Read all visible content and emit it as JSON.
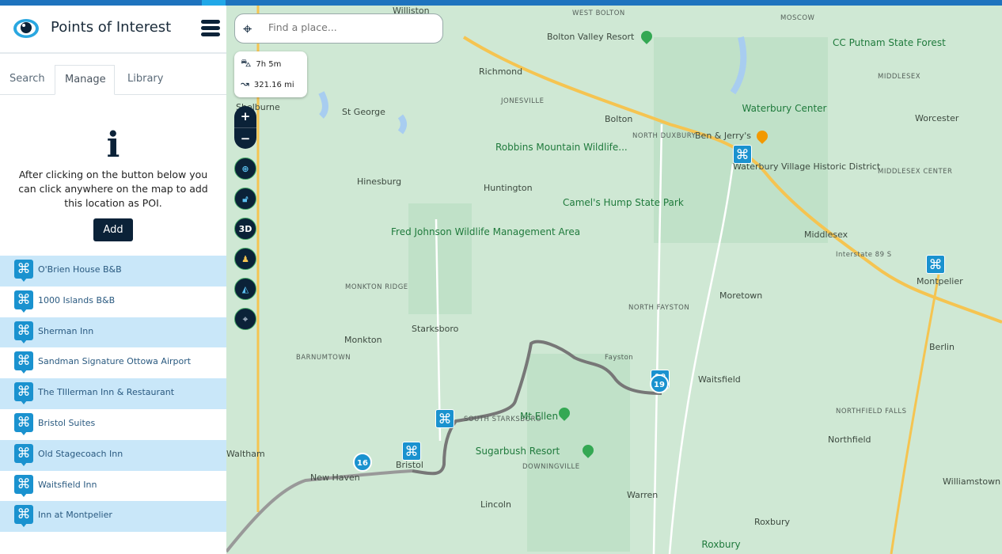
{
  "app": {
    "title": "Points of Interest",
    "logo": "eye-icon",
    "menu_icon": "hamburger-icon"
  },
  "tabs": [
    {
      "label": "Search"
    },
    {
      "label": "Manage",
      "active": true
    },
    {
      "label": "Library"
    }
  ],
  "manage": {
    "info_icon": "i",
    "text": "After clicking on the button below you can click anywhere on the map to add this location as POI.",
    "add_label": "Add"
  },
  "poi_list": [
    {
      "name": "O'Brien House B&B"
    },
    {
      "name": "1000 Islands B&B"
    },
    {
      "name": "Sherman Inn"
    },
    {
      "name": "Sandman Signature Ottowa Airport"
    },
    {
      "name": "The TIllerman Inn & Restaurant"
    },
    {
      "name": "Bristol Suites"
    },
    {
      "name": "Old Stagecoach Inn"
    },
    {
      "name": "Waitsfield Inn"
    },
    {
      "name": "Inn at Montpelier"
    }
  ],
  "map": {
    "search_placeholder": "Find a place...",
    "duration": "7h 5m",
    "distance": "321.16 mi",
    "controls": {
      "zoom_in": "+",
      "zoom_out": "−",
      "three_d": "3D"
    },
    "marker_badges": [
      "16",
      "19"
    ],
    "labels": [
      {
        "t": "Williston"
      },
      {
        "t": "WEST BOLTON"
      },
      {
        "t": "MOSCOW"
      },
      {
        "t": "Bolton Valley Resort"
      },
      {
        "t": "CC Putnam State Forest"
      },
      {
        "t": "Richmond"
      },
      {
        "t": "MIDDLESEX"
      },
      {
        "t": "JONESVILLE"
      },
      {
        "t": "Shelburne"
      },
      {
        "t": "St George"
      },
      {
        "t": "Bolton"
      },
      {
        "t": "Waterbury Center"
      },
      {
        "t": "Worcester"
      },
      {
        "t": "NORTH DUXBURY"
      },
      {
        "t": "Ben & Jerry's"
      },
      {
        "t": "Robbins Mountain Wildlife..."
      },
      {
        "t": "Waterbury Village Historic District"
      },
      {
        "t": "Hinesburg"
      },
      {
        "t": "Huntington"
      },
      {
        "t": "MIDDLESEX CENTER"
      },
      {
        "t": "Camel's Hump State Park"
      },
      {
        "t": "Fred Johnson Wildlife Management Area"
      },
      {
        "t": "Middlesex"
      },
      {
        "t": "Montpelier"
      },
      {
        "t": "MONKTON RIDGE"
      },
      {
        "t": "Moretown"
      },
      {
        "t": "NORTH FAYSTON"
      },
      {
        "t": "Starksboro"
      },
      {
        "t": "Monkton"
      },
      {
        "t": "Fayston"
      },
      {
        "t": "BARNUMTOWN"
      },
      {
        "t": "Waitsfield"
      },
      {
        "t": "Berlin"
      },
      {
        "t": "SOUTH STARKSBORO"
      },
      {
        "t": "Mt Ellen"
      },
      {
        "t": "NORTHFIELD FALLS"
      },
      {
        "t": "Northfield"
      },
      {
        "t": "Sugarbush Resort"
      },
      {
        "t": "Waltham"
      },
      {
        "t": "DOWNINGVILLE"
      },
      {
        "t": "New Haven"
      },
      {
        "t": "Bristol"
      },
      {
        "t": "Williamstown"
      },
      {
        "t": "Lincoln"
      },
      {
        "t": "Warren"
      },
      {
        "t": "Roxbury"
      },
      {
        "t": "Roxbury"
      },
      {
        "t": "Interstate 89 S"
      }
    ]
  },
  "colors": {
    "accent": "#1a92cf",
    "dark": "#0b2238",
    "list_alt": "#c9e7f9",
    "map_bg": "#cfe8d4"
  }
}
